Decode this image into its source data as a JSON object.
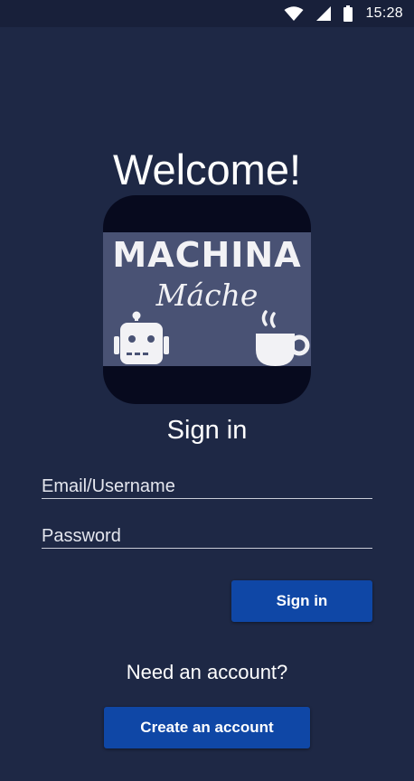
{
  "status_bar": {
    "time": "15:28",
    "icons": [
      "wifi-icon",
      "cell-signal-icon",
      "battery-icon"
    ]
  },
  "welcome": "Welcome!",
  "logo": {
    "title": "MACHINA",
    "subtitle": "Máche",
    "icons": [
      "robot-icon",
      "coffee-cup-icon"
    ],
    "colors": {
      "frame": "#070a1e",
      "band": "#495274",
      "glyph": "#f2f2f5"
    }
  },
  "signin": {
    "title": "Sign in",
    "email_placeholder": "Email/Username",
    "password_placeholder": "Password",
    "button_label": "Sign in"
  },
  "register": {
    "prompt": "Need an account?",
    "button_label": "Create an account"
  },
  "colors": {
    "background": "#1e2845",
    "status_bar": "#18203a",
    "button": "#0f47a6",
    "text": "#ffffff"
  }
}
